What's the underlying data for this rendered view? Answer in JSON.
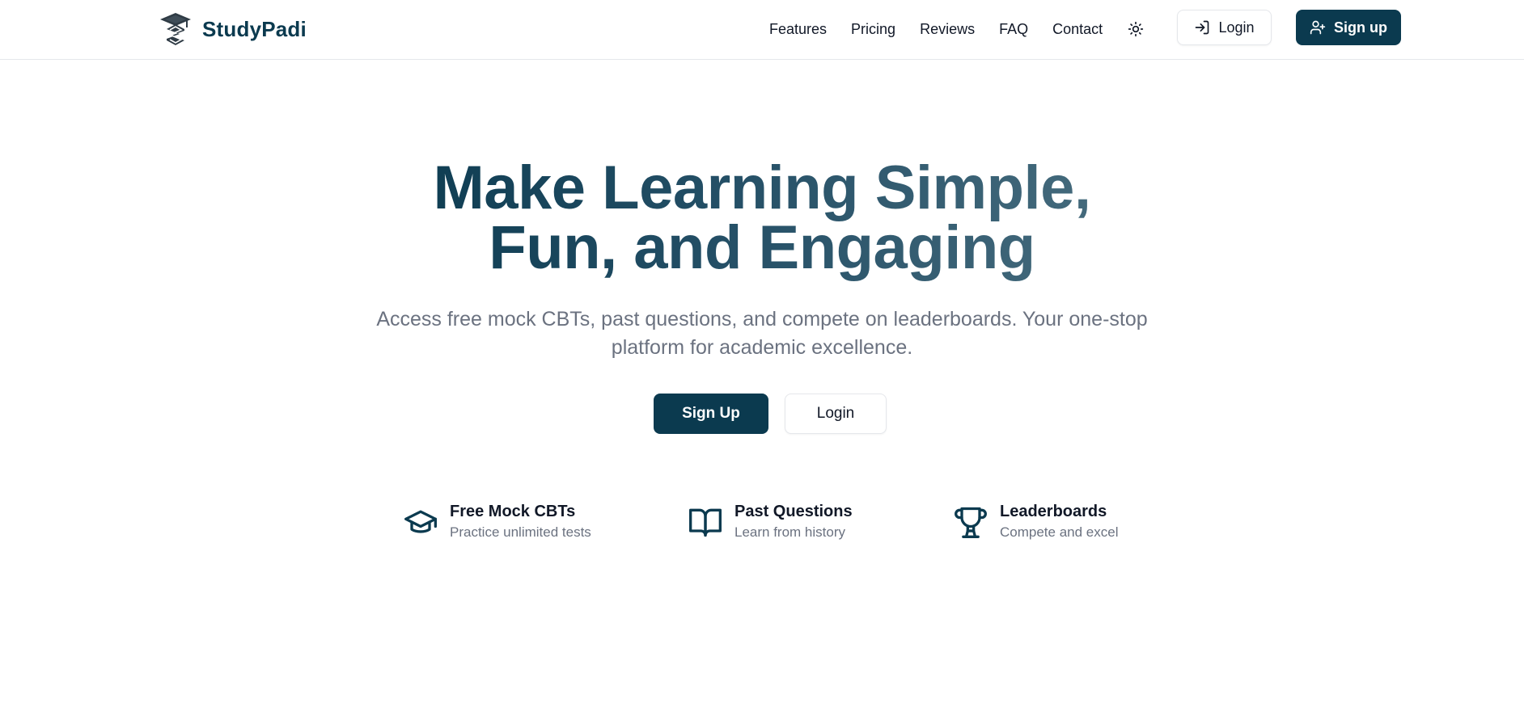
{
  "brand": {
    "name": "StudyPadi",
    "color": "#0b3a4f"
  },
  "nav": {
    "items": [
      "Features",
      "Pricing",
      "Reviews",
      "FAQ",
      "Contact"
    ],
    "theme_icon": "sun-icon",
    "login_label": "Login",
    "signup_label": "Sign up"
  },
  "hero": {
    "title_line1": "Make Learning Simple,",
    "title_line2": "Fun, and Engaging",
    "subtitle": "Access free mock CBTs, past questions, and compete on leaderboards. Your one-stop platform for academic excellence.",
    "signup_label": "Sign Up",
    "login_label": "Login"
  },
  "features": [
    {
      "icon": "graduation-cap-icon",
      "title": "Free Mock CBTs",
      "desc": "Practice unlimited tests"
    },
    {
      "icon": "open-book-icon",
      "title": "Past Questions",
      "desc": "Learn from history"
    },
    {
      "icon": "trophy-icon",
      "title": "Leaderboards",
      "desc": "Compete and excel"
    }
  ],
  "colors": {
    "primary": "#0b3a4f",
    "muted_text": "#6b7280",
    "border": "#e5e7eb"
  }
}
